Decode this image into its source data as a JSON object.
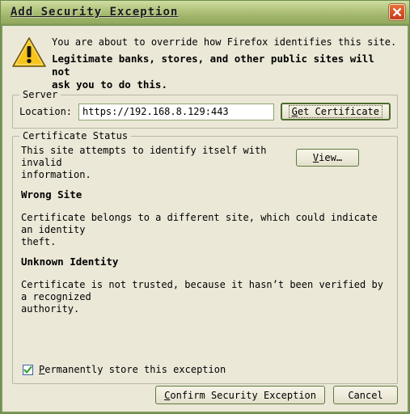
{
  "window": {
    "title": "Add Security Exception",
    "close_icon": "close-icon",
    "frame_color": "#7d9a5a",
    "titlebar_color": "#adc077",
    "client_color": "#ebe8d8"
  },
  "warning": {
    "icon": "warning-triangle-icon",
    "icon_color": "#f5c518",
    "line1": "You are about to override how Firefox identifies this site.",
    "line2_a": "Legitimate banks, stores, and other public sites will not",
    "line2_b": "ask you to do this."
  },
  "server": {
    "group_label": "Server",
    "location_label": "Location:",
    "location_value": "https://192.168.8.129:443",
    "location_placeholder": "https://",
    "get_certificate": {
      "accesskey": "G",
      "rest": "et Certificate",
      "full_label": "Get Certificate",
      "focused": true
    }
  },
  "certificate_status": {
    "group_label": "Certificate Status",
    "intro_line1": "This site attempts to identify itself with invalid",
    "intro_line2": "information.",
    "view_button": {
      "accesskey": "V",
      "rest": "iew…",
      "full_label": "View…"
    },
    "issues": [
      {
        "heading": "Wrong Site",
        "body_line1": "Certificate belongs to a different site, which could indicate an identity",
        "body_line2": "theft."
      },
      {
        "heading": "Unknown Identity",
        "body_line1": "Certificate is not trusted, because it hasn’t been verified by a recognized",
        "body_line2": "authority."
      }
    ]
  },
  "permanent_store": {
    "checked": true,
    "check_icon": "checkmark-icon",
    "check_color": "#2f9e2f",
    "accesskey": "P",
    "rest": "ermanently store this exception",
    "full_label": "Permanently store this exception"
  },
  "footer": {
    "confirm": {
      "accesskey": "C",
      "rest": "onfirm Security Exception",
      "full_label": "Confirm Security Exception"
    },
    "cancel": {
      "full_label": "Cancel"
    }
  }
}
